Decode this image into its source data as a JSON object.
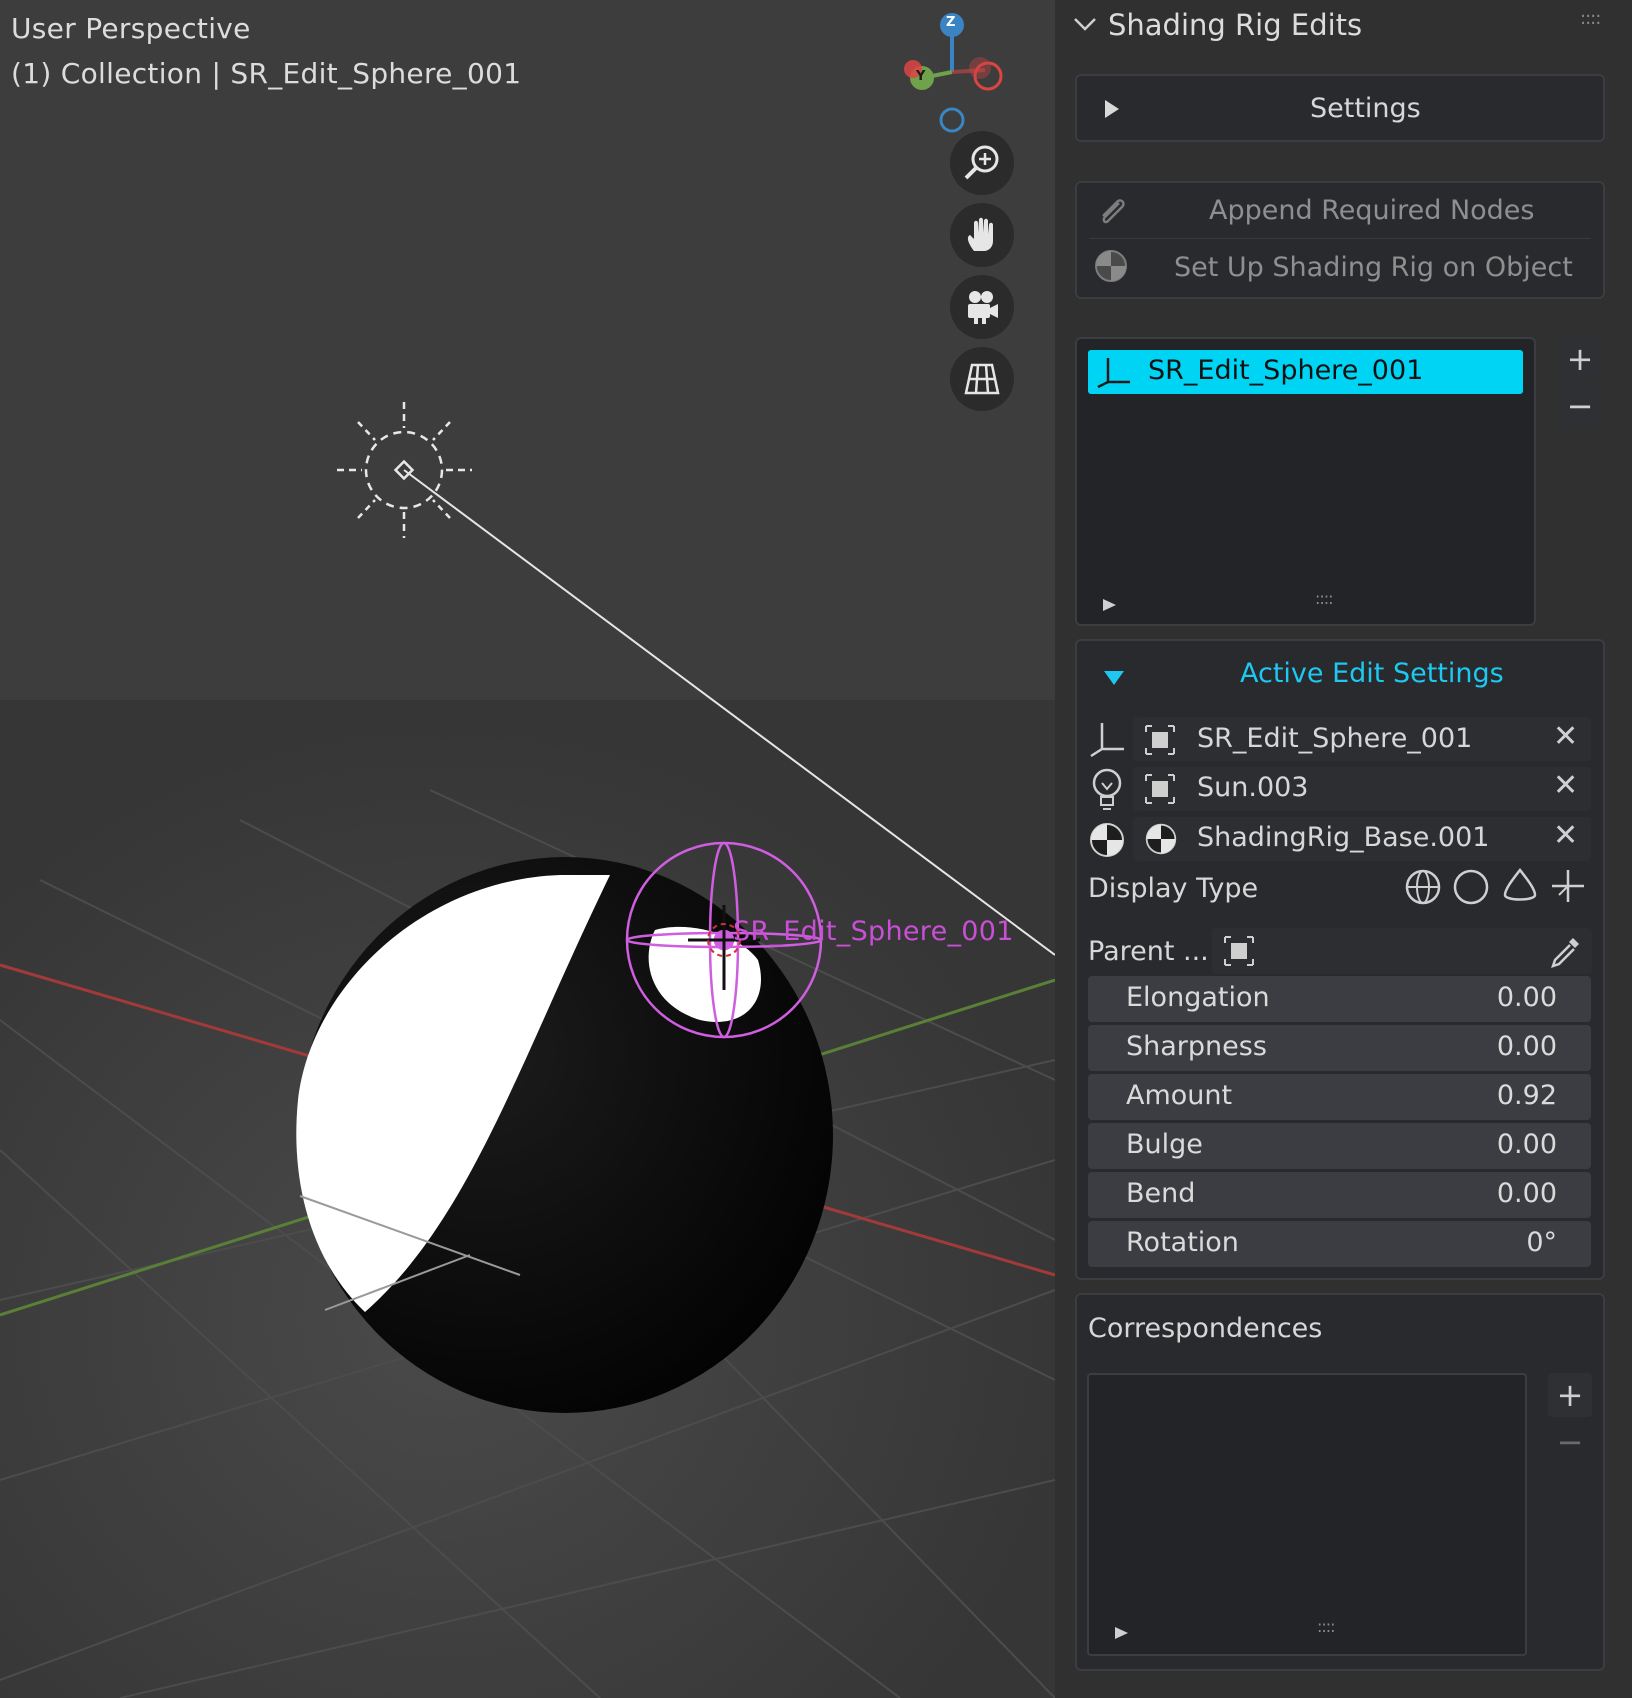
{
  "viewport": {
    "mode_label": "User Perspective",
    "collection_label": "(1) Collection | SR_Edit_Sphere_001",
    "object_label": "SR_Edit_Sphere_001",
    "gizmo_axes": {
      "z": "Z",
      "y": "Y"
    },
    "nav_buttons": [
      "zoom-icon",
      "hand-pan-icon",
      "camera-icon",
      "grid-ortho-icon"
    ]
  },
  "panel": {
    "title": "Shading Rig Edits",
    "settings_label": "Settings",
    "append_nodes_label": "Append Required Nodes",
    "setup_rig_label": "Set Up Shading Rig on Object",
    "list_selected_item": "SR_Edit_Sphere_001",
    "active_edit": {
      "title": "Active Edit Settings",
      "objects": [
        {
          "name": "SR_Edit_Sphere_001",
          "icon": "empty-axes-icon"
        },
        {
          "name": "Sun.003",
          "icon": "light-bulb-icon"
        },
        {
          "name": "ShadingRig_Base.001",
          "icon": "material-sphere-icon"
        }
      ],
      "display_type_label": "Display Type",
      "parent_label": "Parent ...",
      "properties": [
        {
          "label": "Elongation",
          "value": "0.00"
        },
        {
          "label": "Sharpness",
          "value": "0.00"
        },
        {
          "label": "Amount",
          "value": "0.92"
        },
        {
          "label": "Bulge",
          "value": "0.00"
        },
        {
          "label": "Bend",
          "value": "0.00"
        },
        {
          "label": "Rotation",
          "value": "0°"
        }
      ]
    },
    "correspondences_title": "Correspondences"
  },
  "colors": {
    "accent": "#1ec8f0",
    "selection_magenta": "#c94fd6",
    "axis_red": "#b33b3b",
    "axis_green": "#5d8a3a",
    "panel_bg": "#303030",
    "viewport_bg": "#3d3d3d"
  }
}
